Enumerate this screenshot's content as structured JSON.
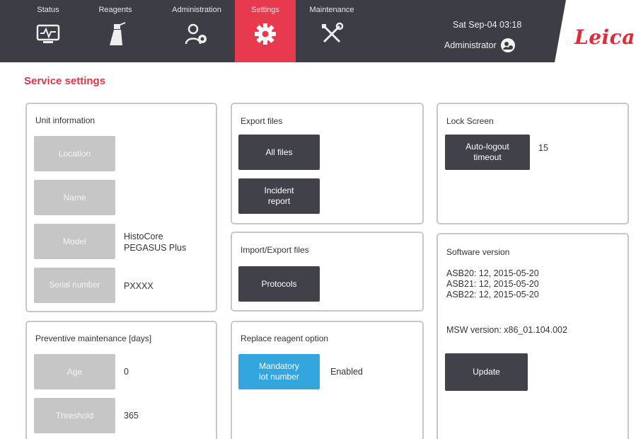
{
  "nav": {
    "tabs": [
      {
        "label": "Status",
        "icon": "status-monitor-icon",
        "active": false
      },
      {
        "label": "Reagents",
        "icon": "reagent-bottle-icon",
        "active": false
      },
      {
        "label": "Administration",
        "icon": "admin-users-gear-icon",
        "active": false
      },
      {
        "label": "Settings",
        "icon": "gear-icon",
        "active": true
      },
      {
        "label": "Maintenance",
        "icon": "tools-icon",
        "active": false
      }
    ],
    "datetime": "Sat Sep-04 03:18",
    "user": "Administrator",
    "logo": "Leica",
    "accent_color": "#e73a4f",
    "bar_color": "#3d3d45"
  },
  "page_title": "Service settings",
  "unit_info": {
    "title": "Unit information",
    "location_label": "Location",
    "name_label": "Name",
    "model_label": "Model",
    "model_value_line1": "HistoCore",
    "model_value_line2": "PEGASUS Plus",
    "serial_label": "Serial number",
    "serial_value": "PXXXX"
  },
  "preventive": {
    "title": "Preventive maintenance [days]",
    "age_label": "Age",
    "age_value": "0",
    "threshold_label": "Threshold",
    "threshold_value": "365"
  },
  "export_files": {
    "title": "Export files",
    "all_files_label": "All files",
    "incident_line1": "Incident",
    "incident_line2": "report"
  },
  "import_export": {
    "title": "Import/Export files",
    "protocols_label": "Protocols"
  },
  "replace_reagent": {
    "title": "Replace reagent option",
    "mandatory_line1": "Mandatory",
    "mandatory_line2": "lot number",
    "status": "Enabled"
  },
  "lock_screen": {
    "title": "Lock Screen",
    "autologout_line1": "Auto-logout",
    "autologout_line2": "timeout",
    "timeout_value": "15"
  },
  "software": {
    "title": "Software version",
    "versions": [
      "ASB20: 12, 2015-05-20",
      "ASB21: 12, 2015-05-20",
      "ASB22: 12, 2015-05-20"
    ],
    "msw": "MSW version: x86_01.104.002",
    "update_label": "Update"
  }
}
